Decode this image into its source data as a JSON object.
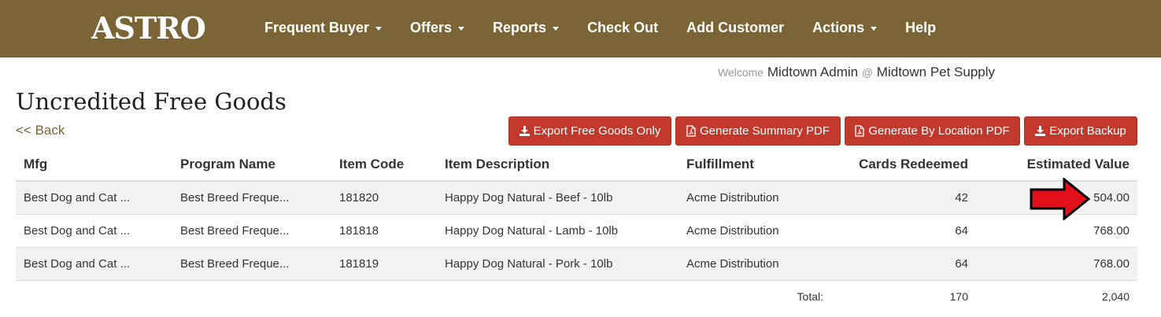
{
  "nav": {
    "brand": "ASTRO",
    "items": [
      {
        "label": "Frequent Buyer",
        "dropdown": true
      },
      {
        "label": "Offers",
        "dropdown": true
      },
      {
        "label": "Reports",
        "dropdown": true
      },
      {
        "label": "Check Out",
        "dropdown": false
      },
      {
        "label": "Add Customer",
        "dropdown": false
      },
      {
        "label": "Actions",
        "dropdown": true
      },
      {
        "label": "Help",
        "dropdown": false
      }
    ]
  },
  "welcome": {
    "prefix": "Welcome",
    "user": "Midtown Admin",
    "at": "@",
    "location": "Midtown Pet Supply"
  },
  "page": {
    "title": "Uncredited Free Goods",
    "back": "<< Back"
  },
  "buttons": {
    "export_free_goods": "Export Free Goods Only",
    "summary_pdf": "Generate Summary PDF",
    "by_location_pdf": "Generate By Location PDF",
    "export_backup": "Export Backup"
  },
  "table": {
    "headers": [
      "Mfg",
      "Program Name",
      "Item Code",
      "Item Description",
      "Fulfillment",
      "Cards Redeemed",
      "Estimated Value"
    ],
    "rows": [
      {
        "mfg": "Best Dog and Cat ...",
        "program": "Best Breed Freque...",
        "code": "181820",
        "desc": "Happy Dog Natural - Beef - 10lb",
        "fulfillment": "Acme Distribution",
        "cards": "42",
        "value": "504.00"
      },
      {
        "mfg": "Best Dog and Cat ...",
        "program": "Best Breed Freque...",
        "code": "181818",
        "desc": "Happy Dog Natural - Lamb - 10lb",
        "fulfillment": "Acme Distribution",
        "cards": "64",
        "value": "768.00"
      },
      {
        "mfg": "Best Dog and Cat ...",
        "program": "Best Breed Freque...",
        "code": "181819",
        "desc": "Happy Dog Natural - Pork - 10lb",
        "fulfillment": "Acme Distribution",
        "cards": "64",
        "value": "768.00"
      }
    ],
    "total": {
      "label": "Total:",
      "cards": "170",
      "value": "2,040"
    }
  },
  "colors": {
    "navbar": "#7b6436",
    "button": "#c0392b",
    "link": "#7b6436",
    "value_text": "#b03a2e",
    "arrow": "#e3101a"
  },
  "icons": {
    "download": "download-icon",
    "pdf": "pdf-file-icon",
    "arrow": "red-arrow-icon"
  }
}
